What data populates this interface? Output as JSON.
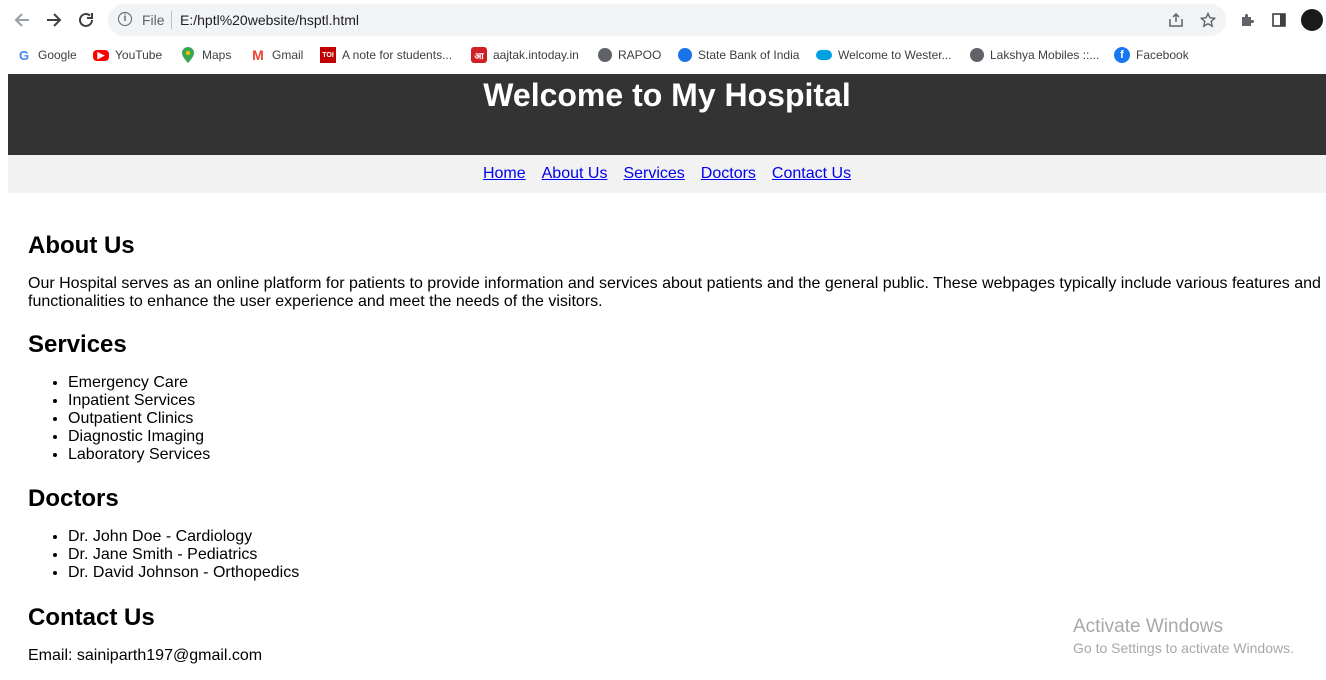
{
  "browser": {
    "address": {
      "scheme_label": "File",
      "url": "E:/hptl%20website/hsptl.html"
    },
    "icons": {
      "back": "arrow-left",
      "forward": "arrow-right",
      "reload": "reload",
      "info": "info",
      "share": "share",
      "bookmark_star": "star",
      "extensions": "puzzle",
      "side_panel": "side-panel",
      "profile": "avatar"
    },
    "bookmarks": [
      {
        "label": "Google",
        "icon": "google-icon",
        "color": "#4285f4"
      },
      {
        "label": "YouTube",
        "icon": "youtube-icon",
        "color": "#ff0000"
      },
      {
        "label": "Maps",
        "icon": "maps-icon",
        "color": "#34a853"
      },
      {
        "label": "Gmail",
        "icon": "gmail-icon",
        "color": "#ea4335"
      },
      {
        "label": "A note for students...",
        "icon": "toi-icon",
        "color": "#c00000"
      },
      {
        "label": "aajtak.intoday.in",
        "icon": "aajtak-icon",
        "color": "#d11f26"
      },
      {
        "label": "RAPOO",
        "icon": "globe-icon",
        "color": "#5f6368"
      },
      {
        "label": "State Bank of India",
        "icon": "sbi-icon",
        "color": "#1a73e8"
      },
      {
        "label": "Welcome to Wester...",
        "icon": "cloud-icon",
        "color": "#00a1e0"
      },
      {
        "label": "Lakshya Mobiles ::...",
        "icon": "globe-icon",
        "color": "#5f6368"
      },
      {
        "label": "Facebook",
        "icon": "facebook-icon",
        "color": "#1877f2"
      }
    ]
  },
  "site": {
    "title": "Welcome to My Hospital",
    "nav": [
      "Home",
      "About Us",
      "Services",
      "Doctors",
      "Contact Us"
    ],
    "about": {
      "heading": "About Us",
      "text": "Our Hospital serves as an online platform for patients to provide information and services about patients and the general public. These webpages typically include various features and functionalities to enhance the user experience and meet the needs of the visitors."
    },
    "services": {
      "heading": "Services",
      "items": [
        "Emergency Care",
        "Inpatient Services",
        "Outpatient Clinics",
        "Diagnostic Imaging",
        "Laboratory Services"
      ]
    },
    "doctors": {
      "heading": "Doctors",
      "items": [
        "Dr. John Doe - Cardiology",
        "Dr. Jane Smith - Pediatrics",
        "Dr. David Johnson - Orthopedics"
      ]
    },
    "contact": {
      "heading": "Contact Us",
      "email": "Email: sainiparth197@gmail.com"
    }
  },
  "watermark": {
    "line1": "Activate Windows",
    "line2": "Go to Settings to activate Windows."
  },
  "colors": {
    "header_bg": "#333333",
    "nav_bg": "#f2f2f2",
    "link": "#0000ee"
  }
}
